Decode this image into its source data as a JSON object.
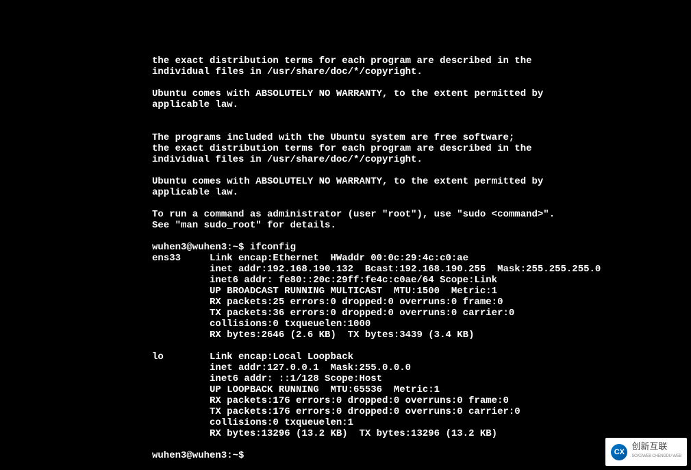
{
  "terminal": {
    "motd": [
      "the exact distribution terms for each program are described in the",
      "individual files in /usr/share/doc/*/copyright.",
      "",
      "Ubuntu comes with ABSOLUTELY NO WARRANTY, to the extent permitted by",
      "applicable law.",
      "",
      "",
      "The programs included with the Ubuntu system are free software;",
      "the exact distribution terms for each program are described in the",
      "individual files in /usr/share/doc/*/copyright.",
      "",
      "Ubuntu comes with ABSOLUTELY NO WARRANTY, to the extent permitted by",
      "applicable law.",
      "",
      "To run a command as administrator (user \"root\"), use \"sudo <command>\".",
      "See \"man sudo_root\" for details.",
      ""
    ],
    "prompt1": "wuhen3@wuhen3:~$ ",
    "command1": "ifconfig",
    "ifconfig_output": [
      "ens33     Link encap:Ethernet  HWaddr 00:0c:29:4c:c0:ae",
      "          inet addr:192.168.190.132  Bcast:192.168.190.255  Mask:255.255.255.0",
      "          inet6 addr: fe80::20c:29ff:fe4c:c0ae/64 Scope:Link",
      "          UP BROADCAST RUNNING MULTICAST  MTU:1500  Metric:1",
      "          RX packets:25 errors:0 dropped:0 overruns:0 frame:0",
      "          TX packets:36 errors:0 dropped:0 overruns:0 carrier:0",
      "          collisions:0 txqueuelen:1000",
      "          RX bytes:2646 (2.6 KB)  TX bytes:3439 (3.4 KB)",
      "",
      "lo        Link encap:Local Loopback",
      "          inet addr:127.0.0.1  Mask:255.0.0.0",
      "          inet6 addr: ::1/128 Scope:Host",
      "          UP LOOPBACK RUNNING  MTU:65536  Metric:1",
      "          RX packets:176 errors:0 dropped:0 overruns:0 frame:0",
      "          TX packets:176 errors:0 dropped:0 overruns:0 carrier:0",
      "          collisions:0 txqueuelen:1",
      "          RX bytes:13296 (13.2 KB)  TX bytes:13296 (13.2 KB)",
      ""
    ],
    "prompt2": "wuhen3@wuhen3:~$ "
  },
  "watermark": {
    "brand": "创新互联",
    "logo_text": "CX",
    "sub": "SCKGWEB CHENGDU-WEB"
  }
}
